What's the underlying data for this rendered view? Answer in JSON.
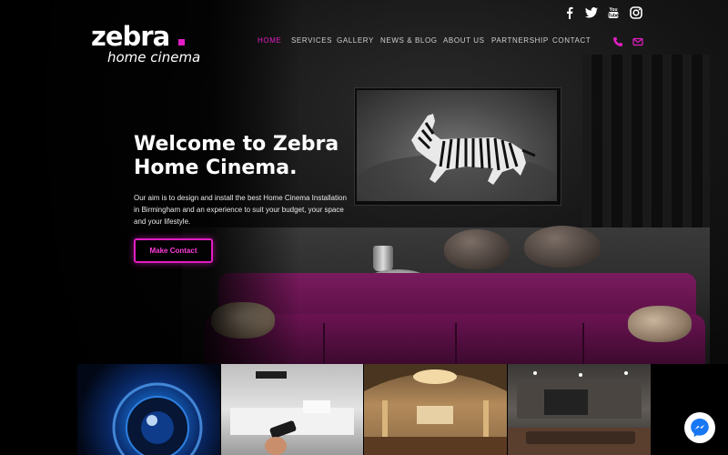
{
  "brand": {
    "name": "zebra",
    "tagline": "home cinema",
    "accent_color": "#e01ec2"
  },
  "social": [
    {
      "name": "facebook",
      "icon": "facebook-icon"
    },
    {
      "name": "twitter",
      "icon": "twitter-icon"
    },
    {
      "name": "youtube",
      "icon": "youtube-icon"
    },
    {
      "name": "instagram",
      "icon": "instagram-icon"
    }
  ],
  "nav": {
    "items": [
      {
        "label": "HOME",
        "active": true
      },
      {
        "label": "SERVICES",
        "active": false
      },
      {
        "label": "GALLERY",
        "active": false
      },
      {
        "label": "NEWS & BLOG",
        "active": false
      },
      {
        "label": "ABOUT US",
        "active": false
      },
      {
        "label": "PARTNERSHIP",
        "active": false
      },
      {
        "label": "CONTACT",
        "active": false
      }
    ],
    "contact_icons": [
      "phone-icon",
      "mail-icon"
    ]
  },
  "hero": {
    "headline_line1": "Welcome to Zebra",
    "headline_line2": "Home Cinema.",
    "intro": "Our aim is to design and install the best Home Cinema Installation in Birmingham and an experience to suit your budget, your space and your lifestyle.",
    "cta_label": "Make Contact"
  },
  "gallery": {
    "tiles": [
      "camera-lens",
      "remote-control-room",
      "grand-cinema-hall",
      "media-room"
    ]
  },
  "chat": {
    "icon": "messenger-icon"
  }
}
